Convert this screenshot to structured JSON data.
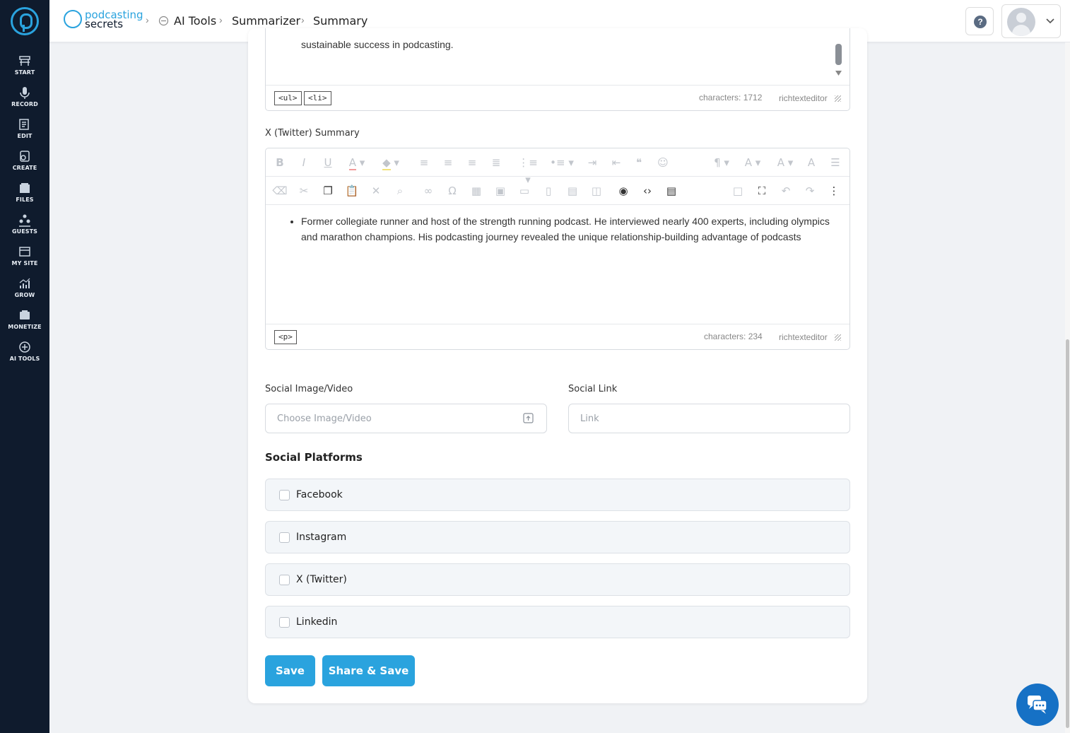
{
  "sidebar": {
    "items": [
      {
        "label": "START",
        "icon": "start-icon"
      },
      {
        "label": "RECORD",
        "icon": "microphone-icon"
      },
      {
        "label": "EDIT",
        "icon": "edit-icon"
      },
      {
        "label": "CREATE",
        "icon": "create-icon"
      },
      {
        "label": "FILES",
        "icon": "files-icon"
      },
      {
        "label": "GUESTS",
        "icon": "guests-icon"
      },
      {
        "label": "MY SITE",
        "icon": "my-site-icon"
      },
      {
        "label": "GROW",
        "icon": "grow-icon"
      },
      {
        "label": "MONETIZE",
        "icon": "monetize-icon"
      },
      {
        "label": "AI TOOLS",
        "icon": "ai-tools-icon"
      }
    ]
  },
  "header": {
    "brand_top": "podcasting",
    "brand_bottom": "secrets",
    "breadcrumb": [
      "AI Tools",
      "Summarizer",
      "Summary"
    ],
    "help": "?"
  },
  "editor1": {
    "content_tail": "sustainable success in podcasting.",
    "tags": [
      "<ul>",
      "<li>"
    ],
    "char_count": "characters: 1712",
    "brand": "richtexteditor"
  },
  "editor2": {
    "label": "X (Twitter) Summary",
    "content": "Former collegiate runner and host of the strength running podcast. He interviewed nearly 400 experts, including olympics and marathon champions. His podcasting journey revealed the unique relationship-building advantage of podcasts",
    "tags": [
      "<p>"
    ],
    "char_count": "characters: 234",
    "brand": "richtexteditor"
  },
  "social_image": {
    "label": "Social Image/Video",
    "placeholder": "Choose Image/Video"
  },
  "social_link": {
    "label": "Social Link",
    "placeholder": "Link"
  },
  "platforms": {
    "title": "Social Platforms",
    "items": [
      {
        "label": "Facebook",
        "checked": false
      },
      {
        "label": "Instagram",
        "checked": false
      },
      {
        "label": "X (Twitter)",
        "checked": false
      },
      {
        "label": "Linkedin",
        "checked": false
      }
    ]
  },
  "buttons": {
    "save": "Save",
    "share_save": "Share & Save"
  },
  "colors": {
    "accent": "#2aa3de",
    "sidebar": "#0f1b2d",
    "chat": "#1671c5"
  }
}
